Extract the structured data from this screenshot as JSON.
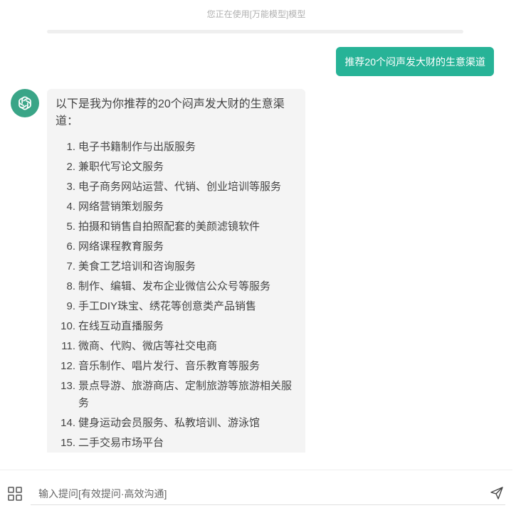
{
  "header": {
    "model_notice": "您正在使用[万能模型]模型"
  },
  "conversation": {
    "user_message": "推荐20个闷声发大财的生意渠道",
    "ai_reply": {
      "intro": "以下是我为你推荐的20个闷声发大财的生意渠道：",
      "items": [
        {
          "num": "1.",
          "text": "电子书籍制作与出版服务"
        },
        {
          "num": "2.",
          "text": "兼职代写论文服务"
        },
        {
          "num": "3.",
          "text": "电子商务网站运营、代销、创业培训等服务"
        },
        {
          "num": "4.",
          "text": "网络营销策划服务"
        },
        {
          "num": "5.",
          "text": "拍摄和销售自拍照配套的美颜滤镜软件"
        },
        {
          "num": "6.",
          "text": "网络课程教育服务"
        },
        {
          "num": "7.",
          "text": "美食工艺培训和咨询服务"
        },
        {
          "num": "8.",
          "text": "制作、编辑、发布企业微信公众号等服务"
        },
        {
          "num": "9.",
          "text": "手工DIY珠宝、绣花等创意类产品销售"
        },
        {
          "num": "10.",
          "text": "在线互动直播服务"
        },
        {
          "num": "11.",
          "text": "微商、代购、微店等社交电商"
        },
        {
          "num": "12.",
          "text": "音乐制作、唱片发行、音乐教育等服务"
        },
        {
          "num": "13.",
          "text": "景点导游、旅游商店、定制旅游等旅游相关服务"
        },
        {
          "num": "14.",
          "text": "健身运动会员服务、私教培训、游泳馆"
        },
        {
          "num": "15.",
          "text": "二手交易市场平台"
        }
      ]
    }
  },
  "input_bar": {
    "placeholder": "输入提问[有效提问·高效沟通]",
    "icons": {
      "apps": "apps-grid-icon",
      "send": "send-icon",
      "avatar": "openai-logo-icon"
    }
  },
  "colors": {
    "accent": "#27b397",
    "avatar_bg": "#3aa587",
    "bubble_bg": "#f4f4f4"
  }
}
